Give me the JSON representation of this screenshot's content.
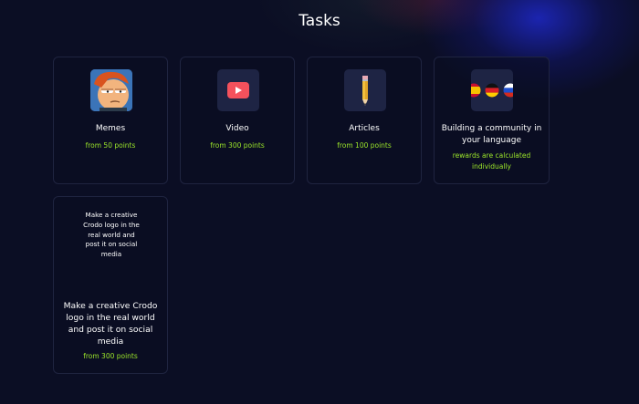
{
  "page": {
    "title": "Tasks"
  },
  "tasks": [
    {
      "title": "Memes",
      "points": "from 50 points",
      "icon": "meme-face-icon"
    },
    {
      "title": "Video",
      "points": "from 300 points",
      "icon": "youtube-play-icon"
    },
    {
      "title": "Articles",
      "points": "from 100 points",
      "icon": "pencil-icon"
    },
    {
      "title": "Building a community in your language",
      "points": "rewards are calculated individually",
      "icon": "language-flags-icon"
    },
    {
      "image_alt": "Make a creative Crodo logo in the real world and post it on social media",
      "title": "Make a creative Crodo logo in the real world and post it on social media",
      "points": "from 300 points"
    }
  ],
  "colors": {
    "background": "#0b0e24",
    "card_border": "#1f2440",
    "thumb_bg": "#1e2444",
    "points": "#9be52a",
    "youtube_red": "#f4515c"
  }
}
